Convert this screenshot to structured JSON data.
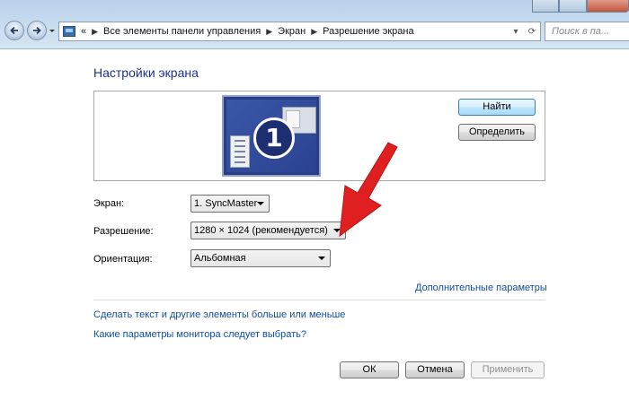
{
  "breadcrumb": {
    "overflow": "«",
    "items": [
      "Все элементы панели управления",
      "Экран",
      "Разрешение экрана"
    ]
  },
  "search": {
    "placeholder": "Поиск в па..."
  },
  "page": {
    "title": "Настройки экрана"
  },
  "preview": {
    "display_number": "1"
  },
  "buttons": {
    "find": "Найти",
    "identify": "Определить",
    "ok": "ОК",
    "cancel": "Отмена",
    "apply": "Применить"
  },
  "fields": {
    "screen": {
      "label": "Экран:",
      "value": "1. SyncMaster"
    },
    "resolution": {
      "label": "Разрешение:",
      "value": "1280 × 1024 (рекомендуется)"
    },
    "orientation": {
      "label": "Ориентация:",
      "value": "Альбомная"
    }
  },
  "links": {
    "advanced": "Дополнительные параметры",
    "text_size": "Сделать текст и другие элементы больше или меньше",
    "which_settings": "Какие параметры монитора следует выбрать?"
  },
  "colors": {
    "heading": "#1e3287",
    "link": "#0f4d9d",
    "annotation_arrow": "#e02020"
  },
  "icons": [
    "back-arrow-icon",
    "forward-arrow-icon",
    "control-panel-icon",
    "refresh-icon",
    "dropdown-icon"
  ]
}
